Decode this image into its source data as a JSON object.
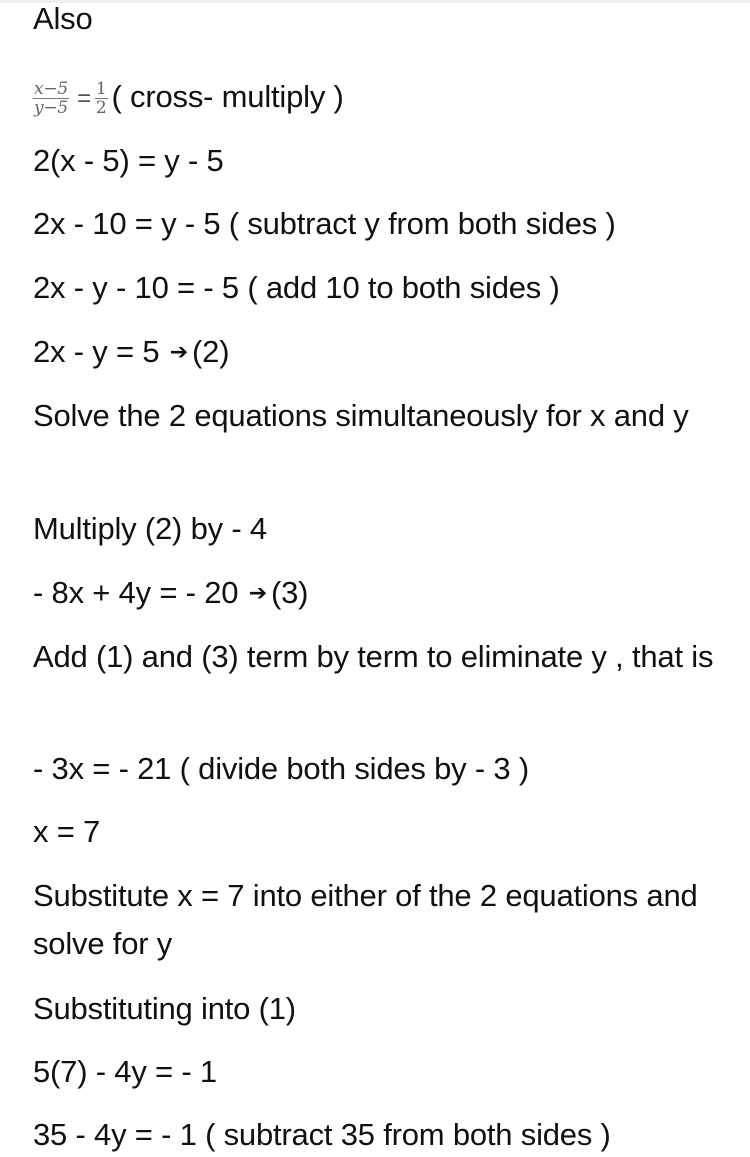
{
  "document": {
    "lines": [
      {
        "id": "l0",
        "text": "Also"
      },
      {
        "id": "l1",
        "fraction_left": {
          "numerator": "x−5",
          "denominator": "y−5"
        },
        "equals": "=",
        "fraction_right": {
          "numerator": "1",
          "denominator": "2"
        },
        "suffix": "( cross- multiply )"
      },
      {
        "id": "l2",
        "text": "2(x - 5) = y - 5"
      },
      {
        "id": "l3",
        "text": "2x - 10 = y - 5 ( subtract y from both sides )"
      },
      {
        "id": "l4",
        "text": "2x - y - 10 = - 5 ( add 10 to both sides )"
      },
      {
        "id": "l5",
        "text": "2x - y = 5",
        "arrow_icon": "right-arrow",
        "label": "(2)"
      },
      {
        "id": "l6",
        "text": "Solve the 2 equations simultaneously for x and y"
      },
      {
        "id": "l7",
        "text": "Multiply (2) by - 4"
      },
      {
        "id": "l8",
        "text": "- 8x + 4y = - 20",
        "arrow_icon": "right-arrow",
        "label": "(3)"
      },
      {
        "id": "l9",
        "text": "Add (1) and (3) term by term to eliminate y , that is"
      },
      {
        "id": "l10",
        "text": "- 3x = - 21 ( divide both sides by - 3 )"
      },
      {
        "id": "l11",
        "text": "x = 7"
      },
      {
        "id": "l12",
        "text": "Substitute x = 7 into either of the 2 equations and solve for y"
      },
      {
        "id": "l13",
        "text": "Substituting into (1)"
      },
      {
        "id": "l14",
        "text": "5(7) - 4y = - 1"
      },
      {
        "id": "l15",
        "text": "35 - 4y = - 1 ( subtract 35 from both sides )"
      }
    ],
    "arrow_glyph": "➔"
  }
}
